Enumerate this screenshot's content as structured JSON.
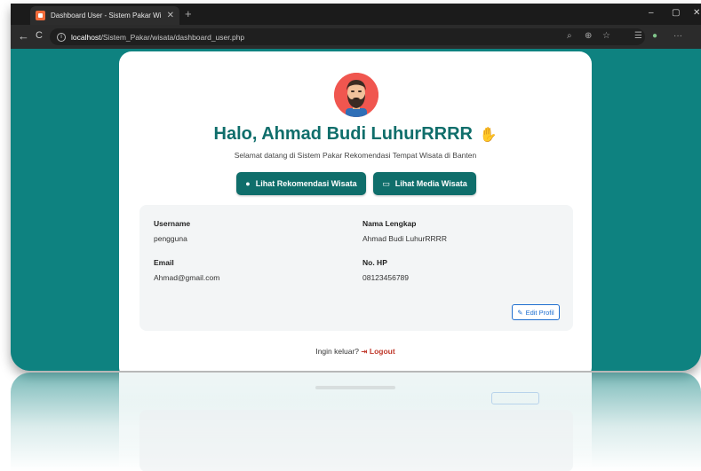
{
  "browser": {
    "tab_title": "Dashboard User - Sistem Pakar Wi",
    "tab_close": "✕",
    "new_tab": "+",
    "url_host": "localhost",
    "url_path": "/Sistem_Pakar/wisata/dashboard_user.php",
    "window_minimize": "–",
    "window_restore": "▢",
    "window_close": "✕",
    "back": "←",
    "reload": "C",
    "more": "···"
  },
  "page": {
    "greeting": "Halo, Ahmad Budi LuhurRRRR",
    "subtitle": "Selamat datang di Sistem Pakar Rekomendasi Tempat Wisata di Banten",
    "buttons": {
      "rekomendasi": "Lihat Rekomendasi Wisata",
      "media": "Lihat Media Wisata"
    },
    "profile": {
      "username_label": "Username",
      "username_value": "pengguna",
      "fullname_label": "Nama Lengkap",
      "fullname_value": "Ahmad Budi LuhurRRRR",
      "email_label": "Email",
      "email_value": "Ahmad@gmail.com",
      "phone_label": "No. HP",
      "phone_value": "08123456789",
      "edit_label": "Edit Profil"
    },
    "logout_prompt": "Ingin keluar?",
    "logout_label": "Logout"
  },
  "colors": {
    "background": "#0e8280",
    "primary": "#0f6e6b",
    "logout": "#c0392b",
    "edit": "#1f6fd0"
  }
}
